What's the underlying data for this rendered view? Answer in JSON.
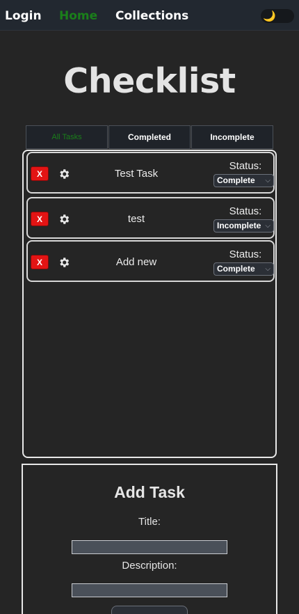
{
  "nav": {
    "login": "Login",
    "home": "Home",
    "collections": "Collections",
    "theme_icon": "moon-icon"
  },
  "page": {
    "title": "Checklist"
  },
  "tabs": [
    {
      "label": "All Tasks",
      "active": true
    },
    {
      "label": "Completed",
      "active": false
    },
    {
      "label": "Incomplete",
      "active": false
    }
  ],
  "tasks": [
    {
      "delete_label": "X",
      "title": "Test Task",
      "status_label": "Status:",
      "status": "Complete"
    },
    {
      "delete_label": "X",
      "title": "test",
      "status_label": "Status:",
      "status": "Incomplete"
    },
    {
      "delete_label": "X",
      "title": "Add new",
      "status_label": "Status:",
      "status": "Complete"
    }
  ],
  "add_task": {
    "heading": "Add Task",
    "title_label": "Title:",
    "title_value": "",
    "description_label": "Description:",
    "description_value": ""
  },
  "colors": {
    "background": "#252525",
    "navbar": "#222830",
    "active_green": "#1a7f1a",
    "delete_red": "#e31414"
  }
}
